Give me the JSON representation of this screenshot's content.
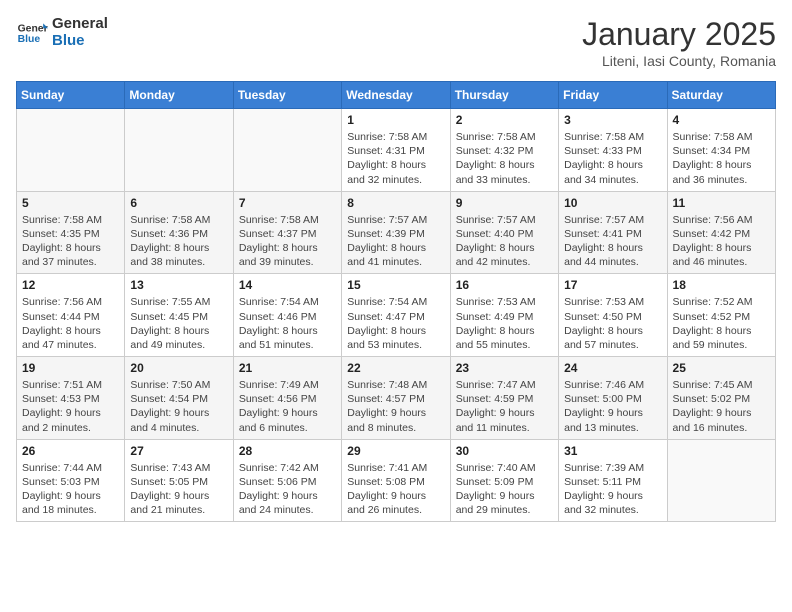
{
  "header": {
    "logo_line1": "General",
    "logo_line2": "Blue",
    "title": "January 2025",
    "subtitle": "Liteni, Iasi County, Romania"
  },
  "days_of_week": [
    "Sunday",
    "Monday",
    "Tuesday",
    "Wednesday",
    "Thursday",
    "Friday",
    "Saturday"
  ],
  "weeks": [
    [
      {
        "day": "",
        "info": ""
      },
      {
        "day": "",
        "info": ""
      },
      {
        "day": "",
        "info": ""
      },
      {
        "day": "1",
        "info": "Sunrise: 7:58 AM\nSunset: 4:31 PM\nDaylight: 8 hours and 32 minutes."
      },
      {
        "day": "2",
        "info": "Sunrise: 7:58 AM\nSunset: 4:32 PM\nDaylight: 8 hours and 33 minutes."
      },
      {
        "day": "3",
        "info": "Sunrise: 7:58 AM\nSunset: 4:33 PM\nDaylight: 8 hours and 34 minutes."
      },
      {
        "day": "4",
        "info": "Sunrise: 7:58 AM\nSunset: 4:34 PM\nDaylight: 8 hours and 36 minutes."
      }
    ],
    [
      {
        "day": "5",
        "info": "Sunrise: 7:58 AM\nSunset: 4:35 PM\nDaylight: 8 hours and 37 minutes."
      },
      {
        "day": "6",
        "info": "Sunrise: 7:58 AM\nSunset: 4:36 PM\nDaylight: 8 hours and 38 minutes."
      },
      {
        "day": "7",
        "info": "Sunrise: 7:58 AM\nSunset: 4:37 PM\nDaylight: 8 hours and 39 minutes."
      },
      {
        "day": "8",
        "info": "Sunrise: 7:57 AM\nSunset: 4:39 PM\nDaylight: 8 hours and 41 minutes."
      },
      {
        "day": "9",
        "info": "Sunrise: 7:57 AM\nSunset: 4:40 PM\nDaylight: 8 hours and 42 minutes."
      },
      {
        "day": "10",
        "info": "Sunrise: 7:57 AM\nSunset: 4:41 PM\nDaylight: 8 hours and 44 minutes."
      },
      {
        "day": "11",
        "info": "Sunrise: 7:56 AM\nSunset: 4:42 PM\nDaylight: 8 hours and 46 minutes."
      }
    ],
    [
      {
        "day": "12",
        "info": "Sunrise: 7:56 AM\nSunset: 4:44 PM\nDaylight: 8 hours and 47 minutes."
      },
      {
        "day": "13",
        "info": "Sunrise: 7:55 AM\nSunset: 4:45 PM\nDaylight: 8 hours and 49 minutes."
      },
      {
        "day": "14",
        "info": "Sunrise: 7:54 AM\nSunset: 4:46 PM\nDaylight: 8 hours and 51 minutes."
      },
      {
        "day": "15",
        "info": "Sunrise: 7:54 AM\nSunset: 4:47 PM\nDaylight: 8 hours and 53 minutes."
      },
      {
        "day": "16",
        "info": "Sunrise: 7:53 AM\nSunset: 4:49 PM\nDaylight: 8 hours and 55 minutes."
      },
      {
        "day": "17",
        "info": "Sunrise: 7:53 AM\nSunset: 4:50 PM\nDaylight: 8 hours and 57 minutes."
      },
      {
        "day": "18",
        "info": "Sunrise: 7:52 AM\nSunset: 4:52 PM\nDaylight: 8 hours and 59 minutes."
      }
    ],
    [
      {
        "day": "19",
        "info": "Sunrise: 7:51 AM\nSunset: 4:53 PM\nDaylight: 9 hours and 2 minutes."
      },
      {
        "day": "20",
        "info": "Sunrise: 7:50 AM\nSunset: 4:54 PM\nDaylight: 9 hours and 4 minutes."
      },
      {
        "day": "21",
        "info": "Sunrise: 7:49 AM\nSunset: 4:56 PM\nDaylight: 9 hours and 6 minutes."
      },
      {
        "day": "22",
        "info": "Sunrise: 7:48 AM\nSunset: 4:57 PM\nDaylight: 9 hours and 8 minutes."
      },
      {
        "day": "23",
        "info": "Sunrise: 7:47 AM\nSunset: 4:59 PM\nDaylight: 9 hours and 11 minutes."
      },
      {
        "day": "24",
        "info": "Sunrise: 7:46 AM\nSunset: 5:00 PM\nDaylight: 9 hours and 13 minutes."
      },
      {
        "day": "25",
        "info": "Sunrise: 7:45 AM\nSunset: 5:02 PM\nDaylight: 9 hours and 16 minutes."
      }
    ],
    [
      {
        "day": "26",
        "info": "Sunrise: 7:44 AM\nSunset: 5:03 PM\nDaylight: 9 hours and 18 minutes."
      },
      {
        "day": "27",
        "info": "Sunrise: 7:43 AM\nSunset: 5:05 PM\nDaylight: 9 hours and 21 minutes."
      },
      {
        "day": "28",
        "info": "Sunrise: 7:42 AM\nSunset: 5:06 PM\nDaylight: 9 hours and 24 minutes."
      },
      {
        "day": "29",
        "info": "Sunrise: 7:41 AM\nSunset: 5:08 PM\nDaylight: 9 hours and 26 minutes."
      },
      {
        "day": "30",
        "info": "Sunrise: 7:40 AM\nSunset: 5:09 PM\nDaylight: 9 hours and 29 minutes."
      },
      {
        "day": "31",
        "info": "Sunrise: 7:39 AM\nSunset: 5:11 PM\nDaylight: 9 hours and 32 minutes."
      },
      {
        "day": "",
        "info": ""
      }
    ]
  ]
}
